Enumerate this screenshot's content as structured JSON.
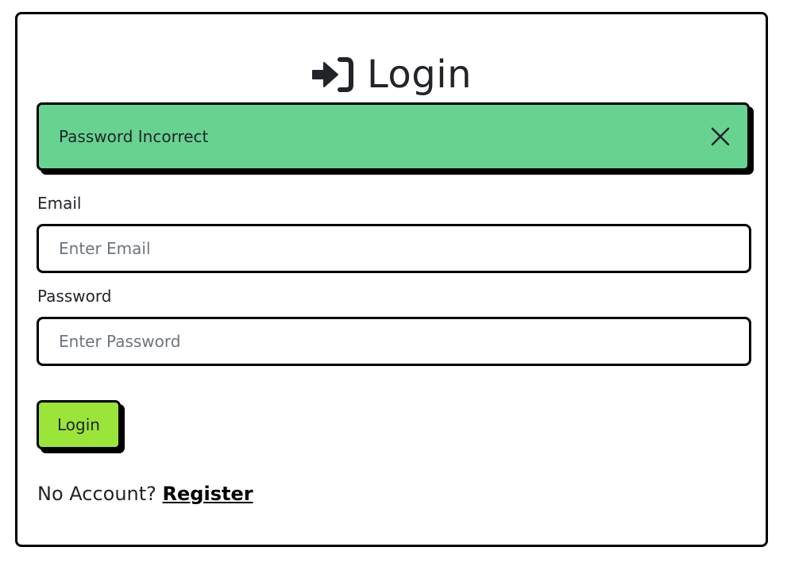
{
  "header": {
    "title": "Login",
    "icon": "sign-in-icon"
  },
  "alert": {
    "message": "Password Incorrect",
    "color": "#68d391",
    "close_icon": "close-icon"
  },
  "form": {
    "email_label": "Email",
    "email_placeholder": "Enter Email",
    "email_value": "",
    "password_label": "Password",
    "password_placeholder": "Enter Password",
    "password_value": "",
    "submit_label": "Login",
    "submit_color": "#9be43a"
  },
  "footer": {
    "prompt": "No Account?",
    "link_label": "Register"
  }
}
